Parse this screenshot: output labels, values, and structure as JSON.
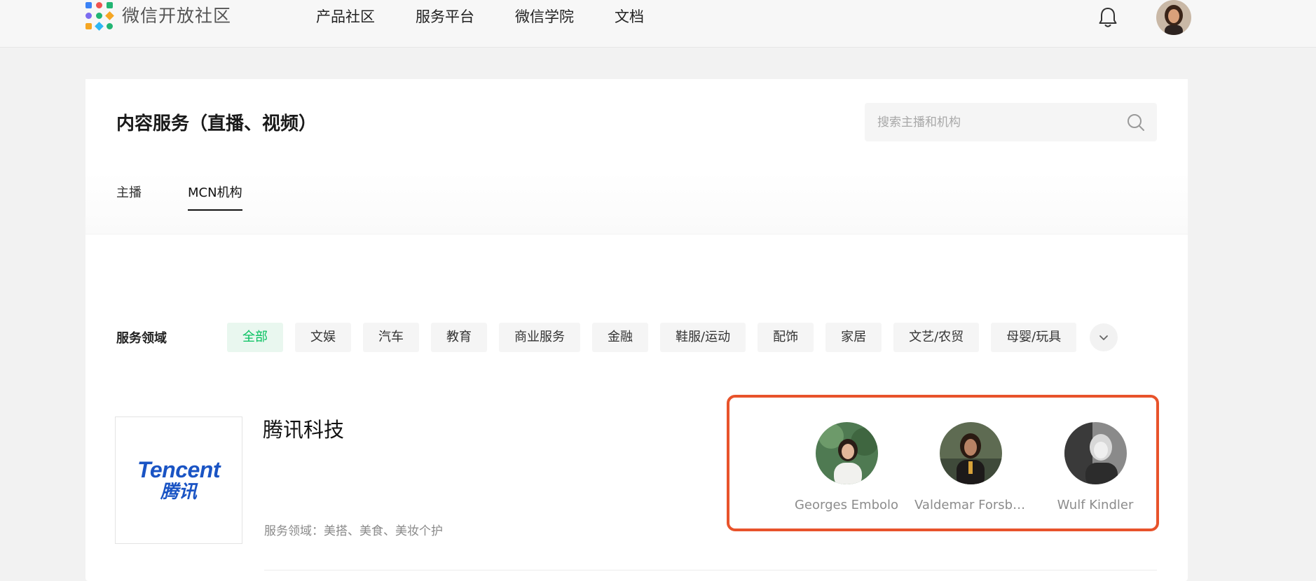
{
  "brand": {
    "name": "微信开放社区"
  },
  "nav": {
    "items": [
      {
        "label": "产品社区"
      },
      {
        "label": "服务平台"
      },
      {
        "label": "微信学院"
      },
      {
        "label": "文档"
      }
    ]
  },
  "header": {
    "title": "内容服务（直播、视频）",
    "search_placeholder": "搜索主播和机构",
    "tabs": [
      {
        "label": "主播",
        "active": false
      },
      {
        "label": "MCN机构",
        "active": true
      }
    ]
  },
  "filters": {
    "label": "服务领域",
    "chips": [
      {
        "label": "全部",
        "active": true
      },
      {
        "label": "文娱"
      },
      {
        "label": "汽车"
      },
      {
        "label": "教育"
      },
      {
        "label": "商业服务"
      },
      {
        "label": "金融"
      },
      {
        "label": "鞋服/运动"
      },
      {
        "label": "配饰"
      },
      {
        "label": "家居"
      },
      {
        "label": "文艺/农贸"
      },
      {
        "label": "母婴/玩具"
      }
    ]
  },
  "org": {
    "logo_text_en": "Tencent",
    "logo_text_zh": "腾讯",
    "name": "腾讯科技",
    "domain": "服务领域：美搭、美食、美妆个护",
    "anchors": [
      {
        "name": "Georges Embolo"
      },
      {
        "name": "Valdemar Forsberg"
      },
      {
        "name": "Wulf Kindler"
      }
    ]
  },
  "colors": {
    "accent": "#07c160",
    "highlight_box": "#e8532b",
    "brand_blue": "#1a54c4"
  }
}
